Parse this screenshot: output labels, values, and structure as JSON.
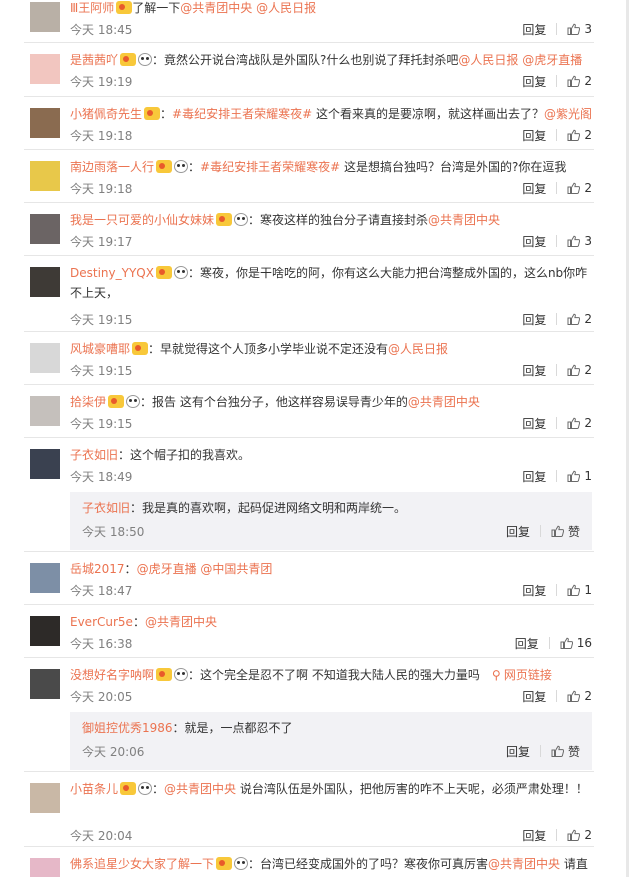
{
  "comments": [
    {
      "user": "Ⅲ王阿师",
      "badge": "gold",
      "emoji": false,
      "text_mentions": [
        "@共青团中央",
        "@人民日报"
      ],
      "text": "了解一下",
      "time": "今天 18:45",
      "reply": "回复",
      "likes": "3",
      "avatar_color": "#b9b0a6"
    },
    {
      "user": "是茜茜吖",
      "badge": "gold",
      "emoji": true,
      "text": "：竟然公开说台湾战队是外国队?什么也别说了拜托封杀吧",
      "text_mentions": [
        "@人民日报",
        "@虎牙直播"
      ],
      "time": "今天 19:19",
      "reply": "回复",
      "likes": "2",
      "avatar_color": "#f2c6c0"
    },
    {
      "user": "小猪佩奇先生",
      "badge": "gold",
      "emoji": false,
      "tag": "#毒纪安排王者荣耀寒夜#",
      "text": " 这个看来真的是要凉啊，就这样画出去了？",
      "text_mentions": [
        "@紫光阁"
      ],
      "time": "今天 19:18",
      "reply": "回复",
      "likes": "2",
      "avatar_color": "#8a6b50"
    },
    {
      "user": "南边雨落一人行",
      "badge": "gold",
      "emoji": true,
      "tag": "#毒纪安排王者荣耀寒夜#",
      "text": " 这是想搞台独吗？台湾是外国的?你在逗我",
      "text_mentions": [],
      "time": "今天 19:18",
      "reply": "回复",
      "likes": "2",
      "avatar_color": "#e8c84a"
    },
    {
      "user": "我是一只可爱的小仙女妹妹",
      "badge": "gold",
      "emoji": true,
      "text": "：寒夜这样的独台分子请直接封杀",
      "text_mentions": [
        "@共青团中央"
      ],
      "time": "今天 19:17",
      "reply": "回复",
      "likes": "3",
      "avatar_color": "#6b6464"
    },
    {
      "user": "Destiny_YYQX",
      "badge": "gold",
      "emoji": true,
      "text": "：寒夜，你是干啥吃的阿，你有这么大能力把台湾整成外国的，这么nb你咋不上天，",
      "text_mentions": [],
      "time": "今天 19:15",
      "reply": "回复",
      "likes": "2",
      "avatar_color": "#3e3a36"
    },
    {
      "user": "风城豪嘈耶",
      "badge": "gold",
      "emoji": false,
      "text": "：早就觉得这个人顶多小学毕业说不定还没有",
      "text_mentions": [
        "@人民日报"
      ],
      "time": "今天 19:15",
      "reply": "回复",
      "likes": "2",
      "avatar_color": "#d8d8d8"
    },
    {
      "user": "拾柒伊",
      "badge": "gold",
      "emoji": true,
      "text": "：报告  这有个台独分子，他这样容易误导青少年的",
      "text_mentions": [
        "@共青团中央"
      ],
      "time": "今天 19:15",
      "reply": "回复",
      "likes": "2",
      "avatar_color": "#c5c0bc"
    },
    {
      "user": "子衣如旧",
      "badge": "none",
      "emoji": false,
      "text": "：这个帽子扣的我喜欢。",
      "text_mentions": [],
      "time": "今天 18:49",
      "reply": "回复",
      "likes": "1",
      "avatar_color": "#3a4150",
      "sub": {
        "user": "子衣如旧",
        "text": "：我是真的喜欢啊，起码促进网络文明和两岸统一。",
        "time": "今天 18:50",
        "reply": "回复",
        "likes": "赞"
      }
    },
    {
      "user": "岳城2017",
      "badge": "none",
      "emoji": false,
      "text": "：",
      "text_mentions": [
        "@虎牙直播",
        "@中国共青团"
      ],
      "time": "今天 18:47",
      "reply": "回复",
      "likes": "1",
      "avatar_color": "#7d8fa6"
    },
    {
      "user": "EverCur5e",
      "badge": "none",
      "emoji": false,
      "text": "：",
      "text_mentions": [
        "@共青团中央"
      ],
      "time": "今天 16:38",
      "reply": "回复",
      "likes": "16",
      "avatar_color": "#2d2a28"
    },
    {
      "user": "没想好名字呐啊",
      "badge": "gold",
      "emoji": true,
      "text": "：这个完全是忍不了啊 不知道我大陆人民的强大力量吗",
      "link": "网页链接",
      "text_mentions": [],
      "time": "今天 20:05",
      "reply": "回复",
      "likes": "2",
      "avatar_color": "#4a4a4a",
      "sub": {
        "user": "御姐控优秀1986",
        "text": "：就是，一点都忍不了",
        "time": "今天 20:06",
        "reply": "回复",
        "likes": "赞"
      }
    },
    {
      "user": "小苗条儿",
      "badge": "gold",
      "emoji": true,
      "text": "：",
      "text_mentions": [
        "@共青团中央"
      ],
      "text_after": " 说台湾队伍是外国队，把他厉害的咋不上天呢，必须严肃处理！！",
      "time": "今天 20:04",
      "reply": "回复",
      "likes": "2",
      "avatar_color": "#c9b8a6"
    },
    {
      "user": "佛系追星少女大家了解一下",
      "badge": "gold",
      "emoji": true,
      "text": "：台湾已经变成国外的了吗？寒夜你可真厉害",
      "text_mentions": [
        "@共青团中央"
      ],
      "text_after": " 请直",
      "avatar_color": "#e6b8c8"
    }
  ]
}
